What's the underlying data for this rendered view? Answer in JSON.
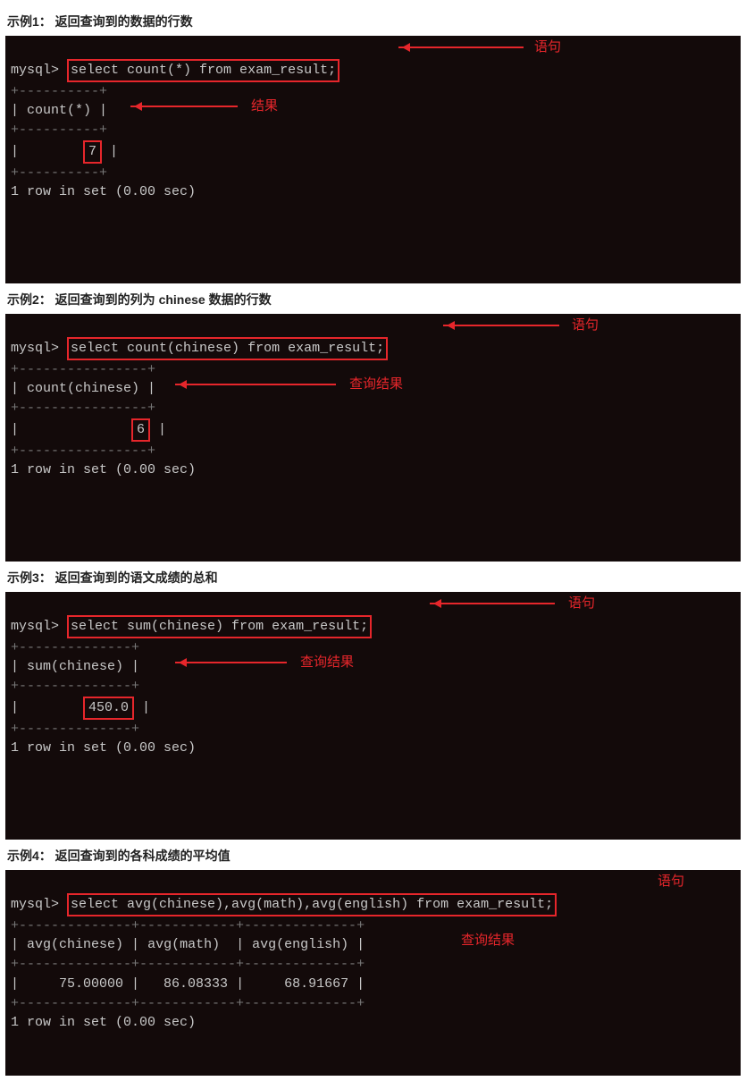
{
  "examples": [
    {
      "title": "示例1：  返回查询到的数据的行数",
      "prompt": "mysql>",
      "sql": "select count(*) from exam_result;",
      "sql_annot": "语句",
      "col_header": "count(*)",
      "value": "7",
      "value_annot": "结果",
      "footer": "1 row in set (0.00 sec)",
      "border_top": "+----------+",
      "border_mid": "+----------+",
      "border_bot": "+----------+"
    },
    {
      "title": "示例2：  返回查询到的列为 chinese 数据的行数",
      "prompt": "mysql>",
      "sql": "select count(chinese) from exam_result;",
      "sql_annot": "语句",
      "col_header": "count(chinese)",
      "value": "6",
      "value_annot": "查询结果",
      "footer": "1 row in set (0.00 sec)",
      "border_top": "+----------------+",
      "border_mid": "+----------------+",
      "border_bot": "+----------------+"
    },
    {
      "title": "示例3：  返回查询到的语文成绩的总和",
      "prompt": "mysql>",
      "sql": "select sum(chinese) from exam_result;",
      "sql_annot": "语句",
      "col_header": "sum(chinese)",
      "value": "450.0",
      "value_annot": "查询结果",
      "footer": "1 row in set (0.00 sec)",
      "border_top": "+--------------+",
      "border_mid": "+--------------+",
      "border_bot": "+--------------+"
    },
    {
      "title": "示例4：  返回查询到的各科成绩的平均值",
      "prompt": "mysql>",
      "sql": "select avg(chinese),avg(math),avg(english) from exam_result;",
      "sql_annot": "语句",
      "cols": [
        "avg(chinese)",
        "avg(math)",
        "avg(english)"
      ],
      "vals": [
        "75.00000",
        "86.08333",
        "68.91667"
      ],
      "value_annot": "查询结果",
      "footer": "1 row in set (0.00 sec)",
      "border": "+--------------+------------+--------------+"
    }
  ]
}
